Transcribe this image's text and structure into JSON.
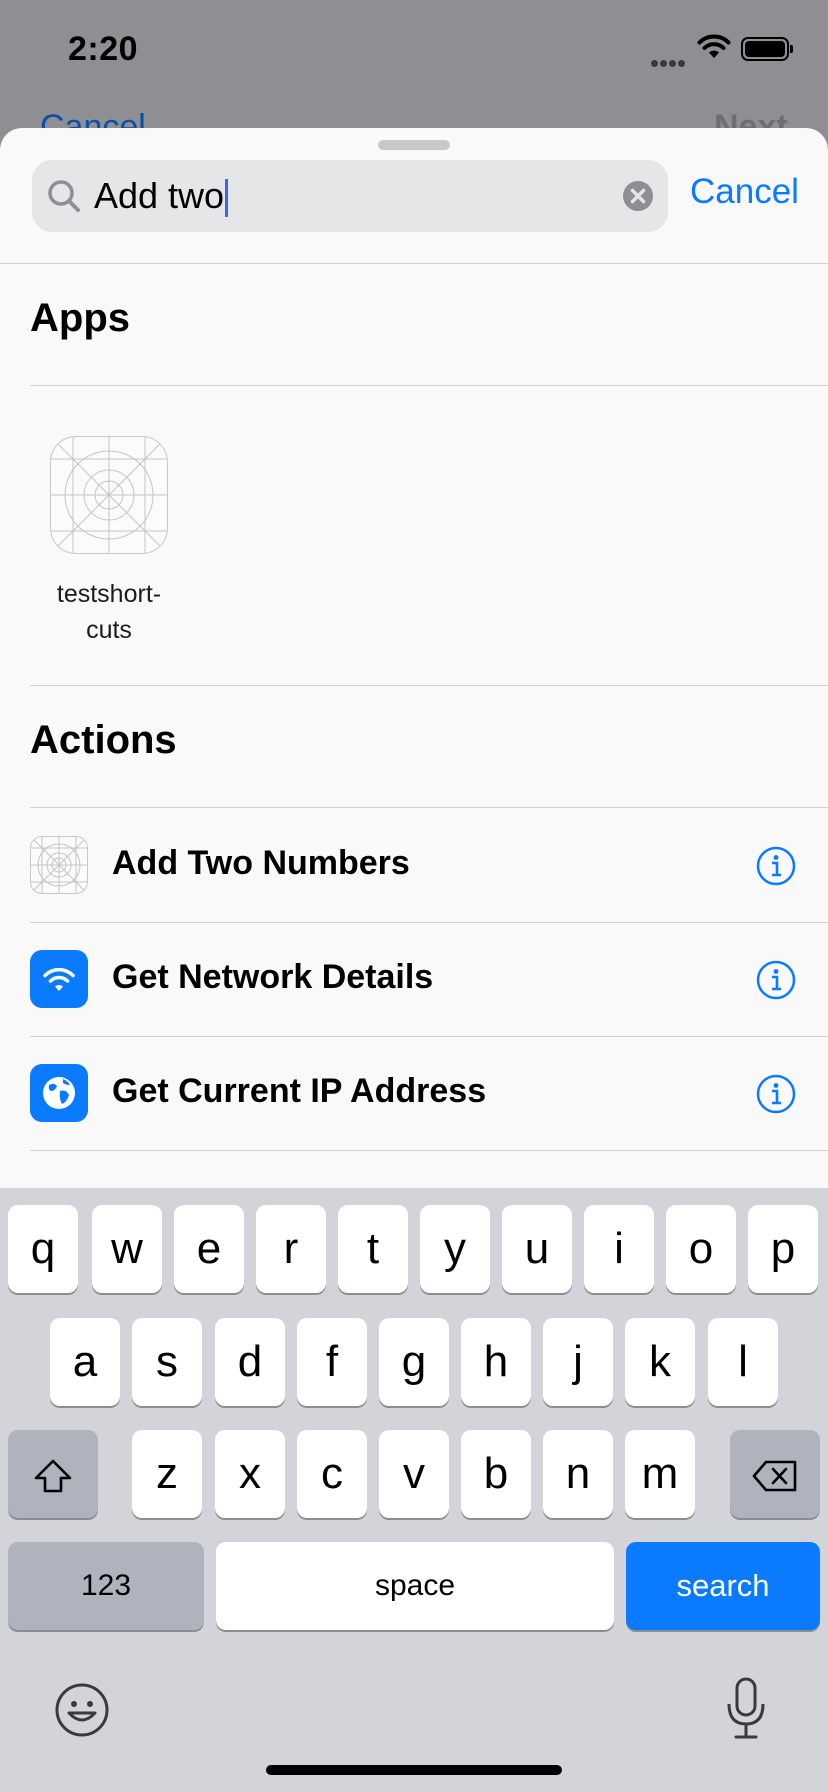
{
  "status": {
    "time": "2:20"
  },
  "background": {
    "cancel": "Cancel",
    "next": "Next"
  },
  "search": {
    "query": "Add two",
    "cancel": "Cancel"
  },
  "apps": {
    "title": "Apps",
    "items": [
      {
        "label": "testshort-\ncuts",
        "icon": "placeholder-grid-icon"
      }
    ]
  },
  "actions": {
    "title": "Actions",
    "items": [
      {
        "label": "Add Two Numbers",
        "icon": "placeholder-grid-icon"
      },
      {
        "label": "Get Network Details",
        "icon": "wifi-icon"
      },
      {
        "label": "Get Current IP Address",
        "icon": "globe-icon"
      }
    ]
  },
  "keyboard": {
    "row1": [
      "q",
      "w",
      "e",
      "r",
      "t",
      "y",
      "u",
      "i",
      "o",
      "p"
    ],
    "row2": [
      "a",
      "s",
      "d",
      "f",
      "g",
      "h",
      "j",
      "k",
      "l"
    ],
    "row3": [
      "z",
      "x",
      "c",
      "v",
      "b",
      "n",
      "m"
    ],
    "numbers": "123",
    "space": "space",
    "search": "search"
  },
  "colors": {
    "accent": "#0a7aff",
    "sheet": "#f9f9f9",
    "keyboard": "#d2d4da"
  }
}
